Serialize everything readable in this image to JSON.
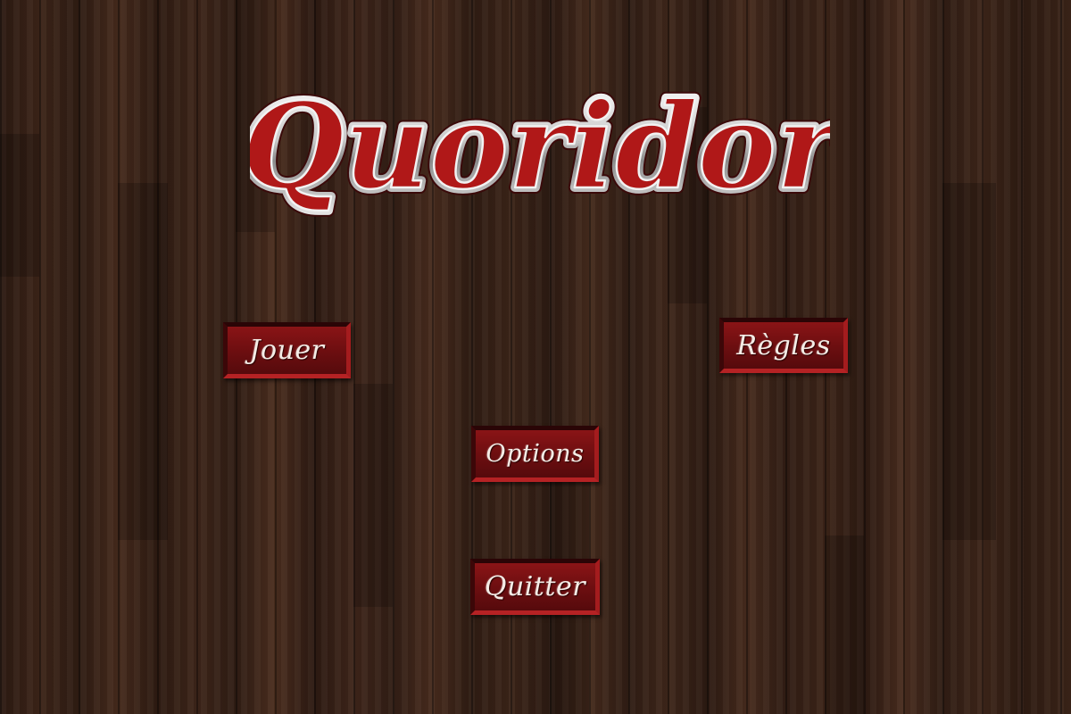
{
  "game": {
    "title": "Quoridor"
  },
  "menu": {
    "play_label": "Jouer",
    "rules_label": "Règles",
    "options_label": "Options",
    "quit_label": "Quitter"
  },
  "colors": {
    "button_red": "#6b0e10",
    "wood_dark": "#2c1a12",
    "wood_light": "#4a2d1e",
    "title_silver": "#d9d9d9",
    "title_red": "#b01818"
  }
}
